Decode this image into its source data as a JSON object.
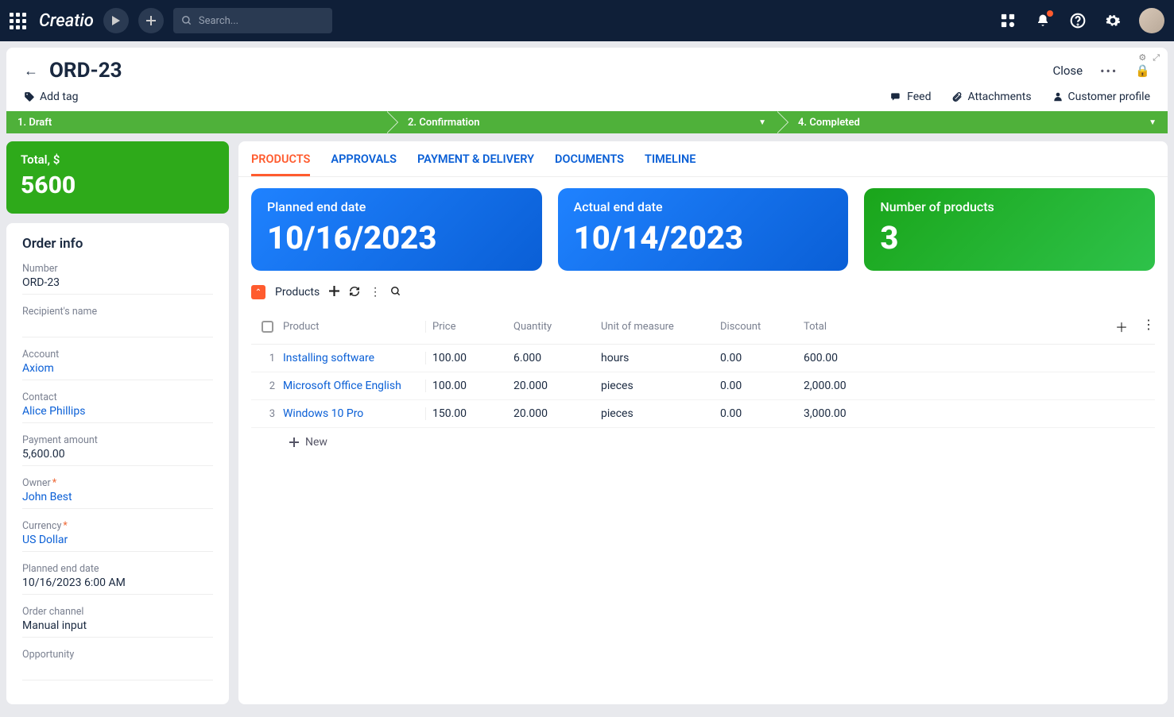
{
  "topbar": {
    "logo": "Creatio",
    "search_placeholder": "Search..."
  },
  "page": {
    "title": "ORD-23",
    "close": "Close",
    "add_tag": "Add tag",
    "links": {
      "feed": "Feed",
      "attachments": "Attachments",
      "customer_profile": "Customer profile"
    }
  },
  "stages": [
    {
      "label": "1. Draft",
      "has_dropdown": false
    },
    {
      "label": "2. Confirmation",
      "has_dropdown": true
    },
    {
      "label": "4. Completed",
      "has_dropdown": true
    }
  ],
  "total": {
    "label": "Total, $",
    "value": "5600"
  },
  "order_info": {
    "title": "Order info",
    "fields": [
      {
        "label": "Number",
        "value": "ORD-23",
        "link": false,
        "req": false
      },
      {
        "label": "Recipient's name",
        "value": "",
        "link": false,
        "req": false
      },
      {
        "label": "Account",
        "value": "Axiom",
        "link": true,
        "req": false
      },
      {
        "label": "Contact",
        "value": "Alice Phillips",
        "link": true,
        "req": false
      },
      {
        "label": "Payment amount",
        "value": "5,600.00",
        "link": false,
        "req": false
      },
      {
        "label": "Owner",
        "value": "John Best",
        "link": true,
        "req": true
      },
      {
        "label": "Currency",
        "value": "US Dollar",
        "link": true,
        "req": true
      },
      {
        "label": "Planned end date",
        "value": "10/16/2023 6:00 AM",
        "link": false,
        "req": false
      },
      {
        "label": "Order channel",
        "value": "Manual input",
        "link": false,
        "req": false
      },
      {
        "label": "Opportunity",
        "value": "",
        "link": false,
        "req": false
      }
    ]
  },
  "tabs": [
    "PRODUCTS",
    "APPROVALS",
    "PAYMENT & DELIVERY",
    "DOCUMENTS",
    "TIMELINE"
  ],
  "metrics": [
    {
      "label": "Planned end date",
      "value": "10/16/2023",
      "color": "blue"
    },
    {
      "label": "Actual end date",
      "value": "10/14/2023",
      "color": "blue"
    },
    {
      "label": "Number of products",
      "value": "3",
      "color": "green"
    }
  ],
  "section": {
    "title": "Products"
  },
  "table": {
    "headers": {
      "product": "Product",
      "price": "Price",
      "quantity": "Quantity",
      "uom": "Unit of measure",
      "discount": "Discount",
      "total": "Total"
    },
    "rows": [
      {
        "n": "1",
        "product": "Installing software",
        "price": "100.00",
        "qty": "6.000",
        "uom": "hours",
        "discount": "0.00",
        "total": "600.00"
      },
      {
        "n": "2",
        "product": "Microsoft Office English",
        "price": "100.00",
        "qty": "20.000",
        "uom": "pieces",
        "discount": "0.00",
        "total": "2,000.00"
      },
      {
        "n": "3",
        "product": "Windows 10 Pro",
        "price": "150.00",
        "qty": "20.000",
        "uom": "pieces",
        "discount": "0.00",
        "total": "3,000.00"
      }
    ],
    "new": "New"
  }
}
